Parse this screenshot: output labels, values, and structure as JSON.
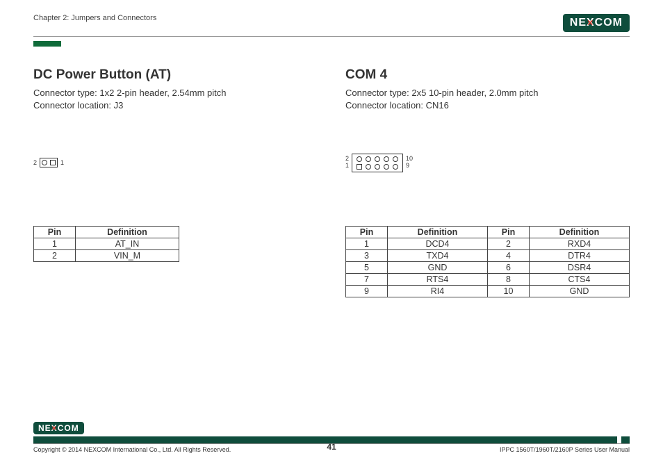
{
  "header": {
    "chapter": "Chapter 2: Jumpers and Connectors",
    "brand": "NEXCOM"
  },
  "left": {
    "title": "DC Power Button (AT)",
    "meta1": "Connector type: 1x2 2-pin header, 2.54mm pitch",
    "meta2": "Connector location: J3",
    "diagram": {
      "label_left": "2",
      "label_right": "1"
    },
    "table": {
      "headers": {
        "pin": "Pin",
        "def": "Definition"
      },
      "rows": [
        {
          "pin": "1",
          "def": "AT_IN"
        },
        {
          "pin": "2",
          "def": "VIN_M"
        }
      ]
    }
  },
  "right": {
    "title": "COM 4",
    "meta1": "Connector type: 2x5 10-pin header, 2.0mm pitch",
    "meta2": "Connector location: CN16",
    "diagram": {
      "left_top": "2",
      "left_bottom": "1",
      "right_top": "10",
      "right_bottom": "9"
    },
    "table": {
      "headers": {
        "pin": "Pin",
        "def": "Definition"
      },
      "rows": [
        {
          "p1": "1",
          "d1": "DCD4",
          "p2": "2",
          "d2": "RXD4"
        },
        {
          "p1": "3",
          "d1": "TXD4",
          "p2": "4",
          "d2": "DTR4"
        },
        {
          "p1": "5",
          "d1": "GND",
          "p2": "6",
          "d2": "DSR4"
        },
        {
          "p1": "7",
          "d1": "RTS4",
          "p2": "8",
          "d2": "CTS4"
        },
        {
          "p1": "9",
          "d1": "RI4",
          "p2": "10",
          "d2": "GND"
        }
      ]
    }
  },
  "footer": {
    "copyright": "Copyright © 2014 NEXCOM International Co., Ltd. All Rights Reserved.",
    "page": "41",
    "doc": "IPPC 1560T/1960T/2160P Series User Manual"
  }
}
